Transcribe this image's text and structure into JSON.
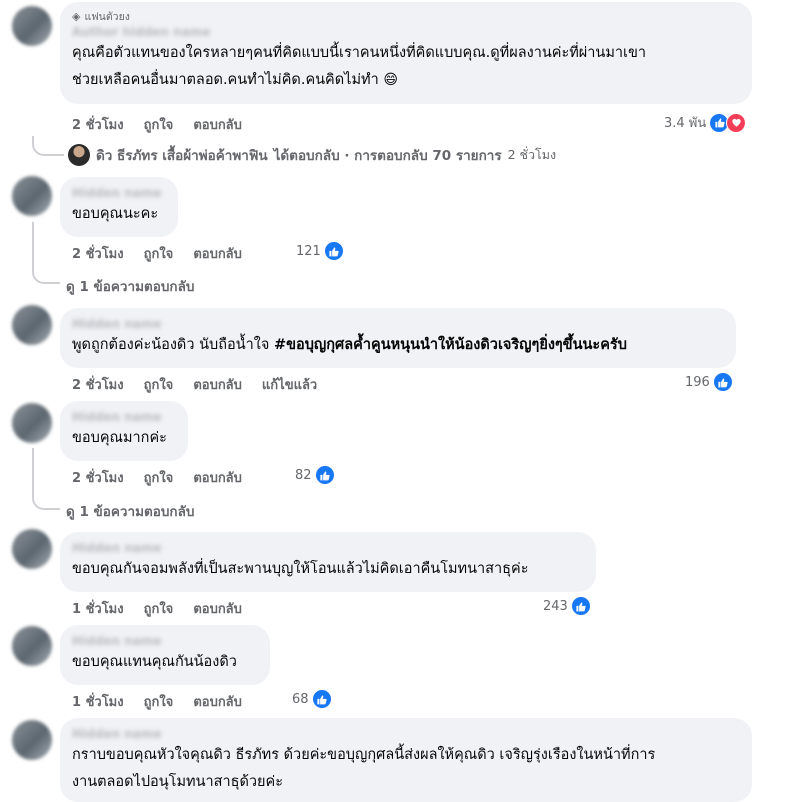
{
  "comments": [
    {
      "badge": "แฟนตัวยง",
      "author": "Author hidden name",
      "line1": "คุณคือตัวแทนของใครหลายๆคนที่คิดแบบนี้เราคนหนึ่งที่คิดแบบคุณ.ดูที่ผลงานค่ะที่ผ่านมาเขา",
      "line2": "ช่วยเหลือคนอื่นมาตลอด.คนทำไม่คิด.คนคิดไม่ทำ",
      "emoji": "😄",
      "time": "2 ชั่วโมง",
      "like": "ถูกใจ",
      "reply": "ตอบกลับ",
      "reactions": "3.4 พัน",
      "reply_summary": {
        "author": "ดิว ธีรภัทร เสื้อผ้าพ่อค้าพาฟิน",
        "replied": "ได้ตอบกลับ · การตอบกลับ 70 รายการ",
        "time": "2 ชั่วโมง"
      }
    },
    {
      "author": "Hidden name",
      "line1": "ขอบคุณนะคะ",
      "time": "2 ชั่วโมง",
      "like": "ถูกใจ",
      "reply": "ตอบกลับ",
      "reactions": "121",
      "view_replies": "ดู 1 ข้อความตอบกลับ"
    },
    {
      "author": "Hidden name",
      "line1_plain": "พูดถูกต้องค่ะน้องดิว นับถือน้ำใจ ",
      "line1_bold": "#ขอบุญกุศลค้ำคูนหนุนนำให้น้องดิวเจริญๆยิ่งๆขึ้นนะครับ",
      "time": "2 ชั่วโมง",
      "like": "ถูกใจ",
      "reply": "ตอบกลับ",
      "edited": "แก้ไขแล้ว",
      "reactions": "196"
    },
    {
      "author": "Hidden name",
      "line1": "ขอบคุณมากค่ะ",
      "time": "2 ชั่วโมง",
      "like": "ถูกใจ",
      "reply": "ตอบกลับ",
      "reactions": "82",
      "view_replies": "ดู 1 ข้อความตอบกลับ"
    },
    {
      "author": "Hidden name",
      "line1": "ขอบคุณกันจอมพลังที่เป็นสะพานบุญให้โอนแล้วไม่คิดเอาคืนโมทนาสาธุค่ะ",
      "time": "1 ชั่วโมง",
      "like": "ถูกใจ",
      "reply": "ตอบกลับ",
      "reactions": "243"
    },
    {
      "author": "Hidden name",
      "line1": "ขอบคุณแทนคุณกันน้องดิว",
      "time": "1 ชั่วโมง",
      "like": "ถูกใจ",
      "reply": "ตอบกลับ",
      "reactions": "68"
    },
    {
      "author": "Hidden name",
      "line1": "กราบขอบคุณหัวใจคุณดิว ธีรภัทร ด้วยค่ะขอบุญกุศลนี้ส่งผลให้คุณดิว เจริญรุ่งเรืองในหน้าที่การ",
      "line2": "งานตลอดไปอนุโมทนาสาธุด้วยค่ะ"
    }
  ],
  "colors": {
    "like": "#1877f2",
    "love": "#f33e58",
    "bubble": "#f0f2f5",
    "meta": "#65676b"
  }
}
